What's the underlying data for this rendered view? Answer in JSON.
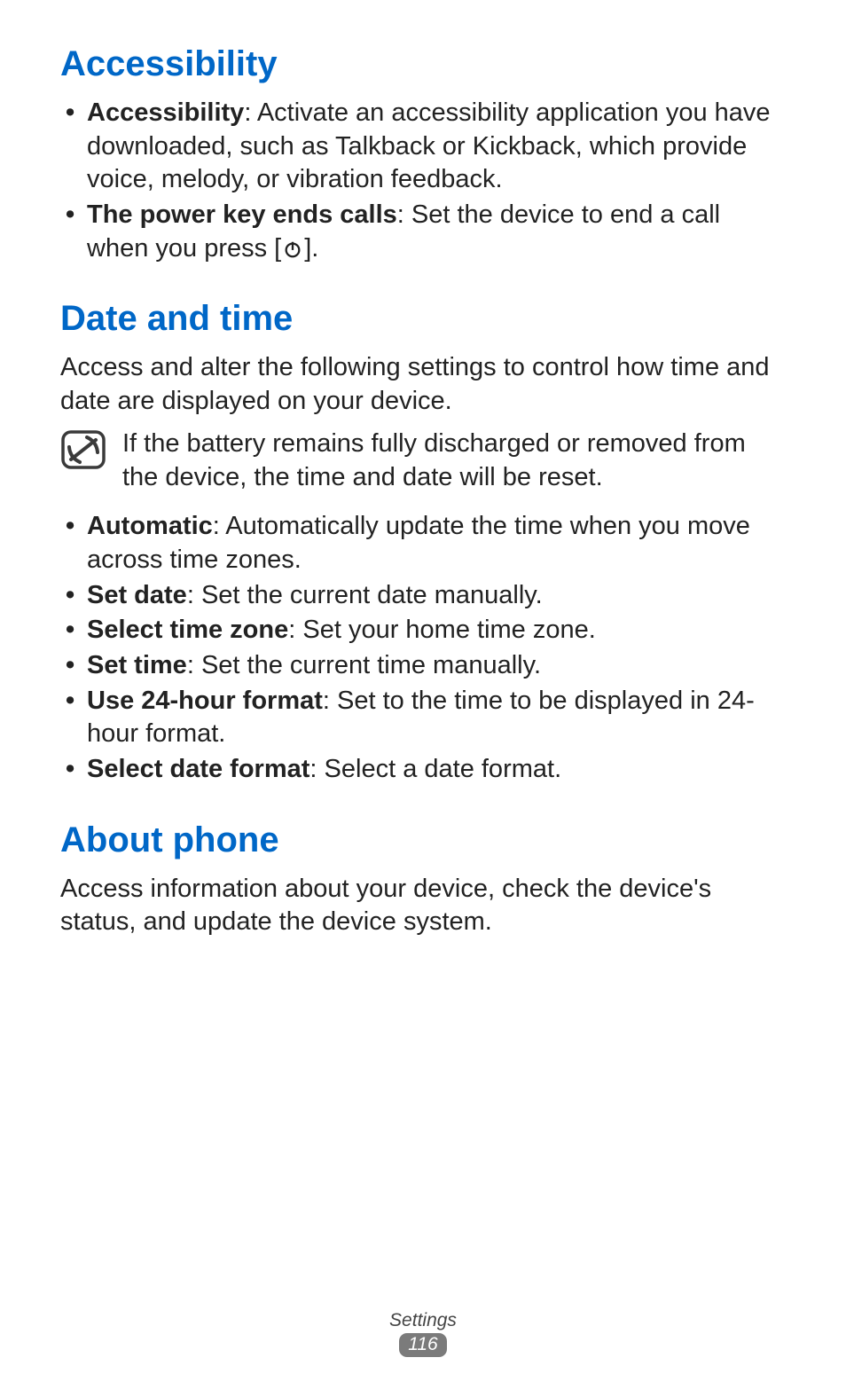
{
  "sections": {
    "accessibility": {
      "heading": "Accessibility",
      "items": [
        {
          "label": "Accessibility",
          "desc": ": Activate an accessibility application you have downloaded, such as Talkback or Kickback, which provide voice, melody, or vibration feedback."
        },
        {
          "label": "The power key ends calls",
          "desc_pre": ": Set the device to end a call when you press [",
          "desc_post": "]."
        }
      ]
    },
    "dateTime": {
      "heading": "Date and time",
      "intro": "Access and alter the following settings to control how time and date are displayed on your device.",
      "note": "If the battery remains fully discharged or removed from the device, the time and date will be reset.",
      "items": [
        {
          "label": "Automatic",
          "desc": ": Automatically update the time when you move across time zones."
        },
        {
          "label": "Set date",
          "desc": ": Set the current date manually."
        },
        {
          "label": "Select time zone",
          "desc": ": Set your home time zone."
        },
        {
          "label": "Set time",
          "desc": ": Set the current time manually."
        },
        {
          "label": "Use 24-hour format",
          "desc": ": Set to the time to be displayed in 24-hour format."
        },
        {
          "label": "Select date format",
          "desc": ": Select a date format."
        }
      ]
    },
    "aboutPhone": {
      "heading": "About phone",
      "intro": "Access information about your device, check the device's status, and update the device system."
    }
  },
  "footer": {
    "section": "Settings",
    "page": "116"
  }
}
